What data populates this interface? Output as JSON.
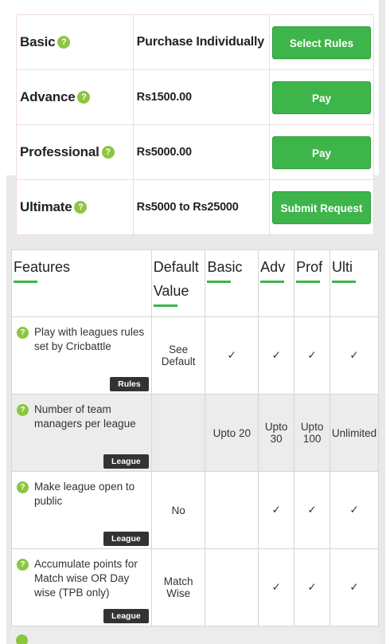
{
  "pricing": {
    "plans": [
      {
        "name": "Basic",
        "price": "Purchase Individually",
        "action": "Select Rules"
      },
      {
        "name": "Advance",
        "price": "Rs1500.00",
        "action": "Pay"
      },
      {
        "name": "Professional",
        "price": "Rs5000.00",
        "action": "Pay"
      },
      {
        "name": "Ultimate",
        "price": "Rs5000 to Rs25000",
        "action": "Submit Request"
      }
    ],
    "help_glyph": "?"
  },
  "features": {
    "headers": {
      "features": "Features",
      "default_line1": "Default",
      "default_line2": "Value",
      "basic": "Basic",
      "adv": "Adv",
      "prof": "Prof",
      "ulti": "Ulti"
    },
    "rows": [
      {
        "text": "Play with leagues rules set by Cricbattle",
        "tag": "Rules",
        "default": "See Default",
        "basic": "✓",
        "adv": "✓",
        "prof": "✓",
        "ulti": "✓"
      },
      {
        "text": "Number of team managers per league",
        "tag": "League",
        "default": "",
        "basic": "Upto 20",
        "adv": "Upto 30",
        "prof": "Upto 100",
        "ulti": "Unlimited"
      },
      {
        "text": "Make league open to public",
        "tag": "League",
        "default": "No",
        "basic": "",
        "adv": "✓",
        "prof": "✓",
        "ulti": "✓"
      },
      {
        "text": "Accumulate points for Match wise OR Day wise (TPB only)",
        "tag": "League",
        "default": "Match Wise",
        "basic": "",
        "adv": "✓",
        "prof": "✓",
        "ulti": "✓"
      }
    ]
  },
  "colors": {
    "accent_green": "#3db54a",
    "help_green": "#8cc63f",
    "check_orange": "#e08a1e",
    "tag_dark": "#333333"
  }
}
